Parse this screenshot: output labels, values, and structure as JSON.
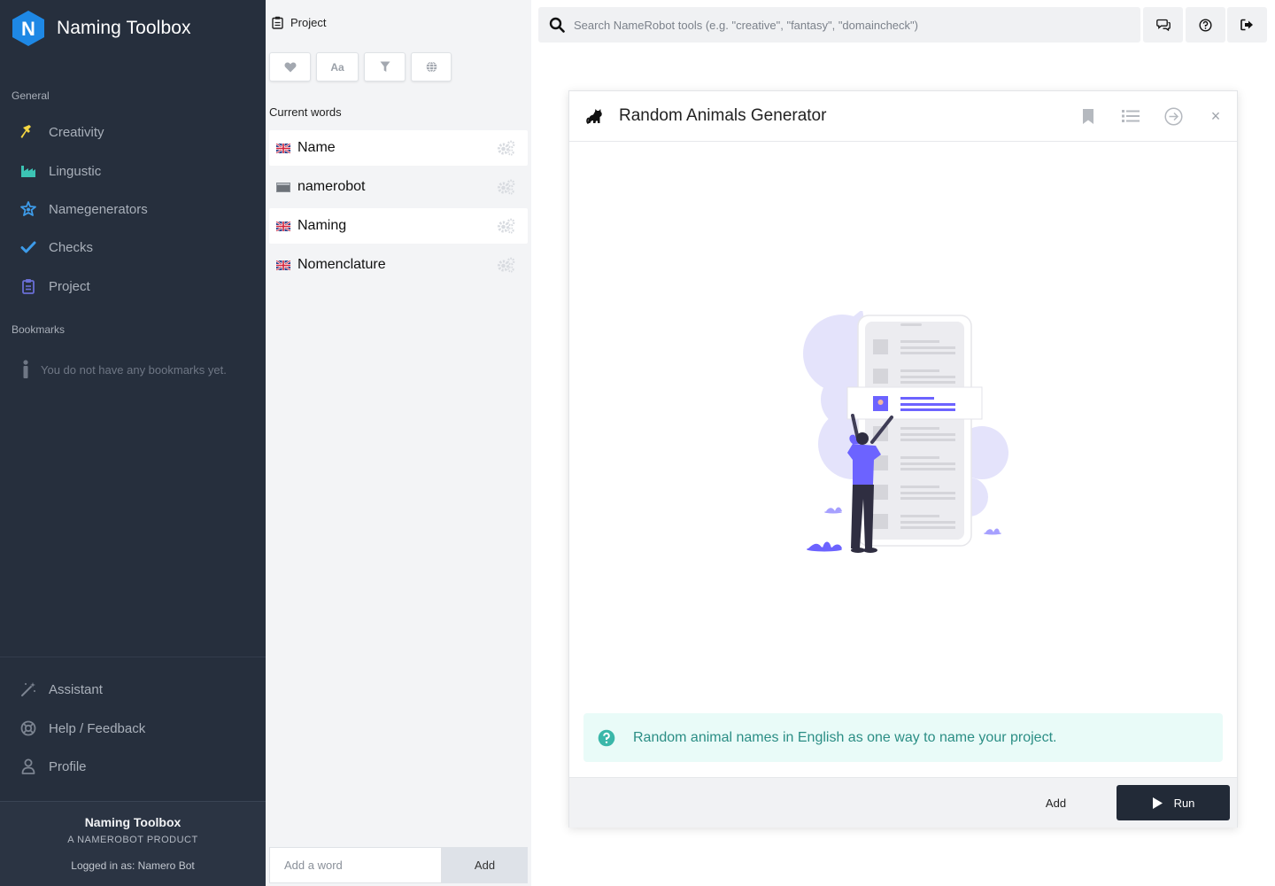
{
  "sidebar": {
    "brand": {
      "logo_letter": "N",
      "title": "Naming Toolbox",
      "logo_color": "#1e88e5"
    },
    "general_title": "General",
    "nav": [
      {
        "label": "Creativity",
        "icon": "hammer-icon",
        "color": "#f5d742"
      },
      {
        "label": "Lingustic",
        "icon": "factory-icon",
        "color": "#3cc4b4"
      },
      {
        "label": "Namegenerators",
        "icon": "star-badge-icon",
        "color": "#3d9be9"
      },
      {
        "label": "Checks",
        "icon": "check-icon",
        "color": "#3d9be9"
      },
      {
        "label": "Project",
        "icon": "clipboard-icon",
        "color": "#6a6fd6"
      }
    ],
    "bookmarks_title": "Bookmarks",
    "bookmarks_empty": "You do not have any bookmarks yet.",
    "bottom_nav": [
      {
        "label": "Assistant",
        "icon": "magic-wand-icon"
      },
      {
        "label": "Help / Feedback",
        "icon": "lifebuoy-icon"
      },
      {
        "label": "Profile",
        "icon": "user-icon"
      }
    ],
    "footer": {
      "title": "Naming Toolbox",
      "subtitle": "A NAMEROBOT PRODUCT",
      "user": "Logged in as: Namero Bot"
    }
  },
  "project": {
    "title": "Project",
    "filters": [
      {
        "icon": "heart-icon",
        "text": ""
      },
      {
        "icon": "font-case-icon",
        "text": "Aa"
      },
      {
        "icon": "filter-icon",
        "text": ""
      },
      {
        "icon": "globe-icon",
        "text": ""
      }
    ],
    "current_words_title": "Current words",
    "words": [
      {
        "word": "Name",
        "flag": "uk-flag-icon",
        "highlighted": true
      },
      {
        "word": "namerobot",
        "flag": "neutral-flag-icon",
        "highlighted": false
      },
      {
        "word": "Naming",
        "flag": "uk-flag-icon",
        "highlighted": true
      },
      {
        "word": "Nomenclature",
        "flag": "uk-flag-icon",
        "highlighted": false
      }
    ],
    "add_placeholder": "Add a word",
    "add_button": "Add"
  },
  "topbar": {
    "search_placeholder": "Search NameRobot tools (e.g. \"creative\", \"fantasy\", \"domaincheck\")",
    "buttons": [
      "chat-icon",
      "help-circle-icon",
      "logout-icon"
    ]
  },
  "tool": {
    "title": "Random Animals Generator",
    "icon": "cat-icon",
    "header_actions": [
      "bookmark-icon",
      "list-icon",
      "arrow-circle-right-icon",
      "close-icon"
    ],
    "close_glyph": "×",
    "info": "Random animal names in English as one way to name your project.",
    "add_label": "Add",
    "run_label": "Run",
    "accent": "#6c63ff"
  }
}
